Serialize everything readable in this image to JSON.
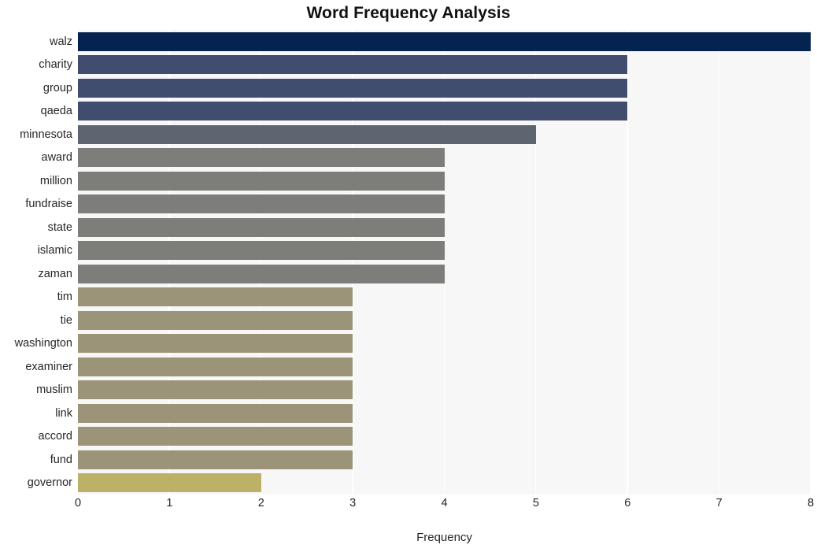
{
  "chart_data": {
    "type": "bar",
    "orientation": "horizontal",
    "title": "Word Frequency Analysis",
    "xlabel": "Frequency",
    "ylabel": "",
    "xlim": [
      0,
      8
    ],
    "xticks": [
      "0",
      "1",
      "2",
      "3",
      "4",
      "5",
      "6",
      "7",
      "8"
    ],
    "grid": "vertical-only",
    "legend": "none",
    "categories": [
      "walz",
      "charity",
      "group",
      "qaeda",
      "minnesota",
      "award",
      "million",
      "fundraise",
      "state",
      "islamic",
      "zaman",
      "tim",
      "tie",
      "washington",
      "examiner",
      "muslim",
      "link",
      "accord",
      "fund",
      "governor"
    ],
    "values": [
      8,
      6,
      6,
      6,
      5,
      4,
      4,
      4,
      4,
      4,
      4,
      3,
      3,
      3,
      3,
      3,
      3,
      3,
      3,
      2
    ],
    "bar_colors": [
      "#042351",
      "#414d6e",
      "#414d6e",
      "#414d6e",
      "#5f6471",
      "#7d7d7a",
      "#7d7d7a",
      "#7d7d7a",
      "#7d7d7a",
      "#7d7d7a",
      "#7d7d7a",
      "#9b9478",
      "#9b9478",
      "#9b9478",
      "#9b9478",
      "#9b9478",
      "#9b9478",
      "#9b9478",
      "#9b9478",
      "#bdb067"
    ]
  },
  "style": {
    "plot_background": "#f7f7f8",
    "figure_background": "#ffffff",
    "gridline_color": "#ffffff",
    "text_color": "#262626",
    "title_color": "#111111"
  }
}
